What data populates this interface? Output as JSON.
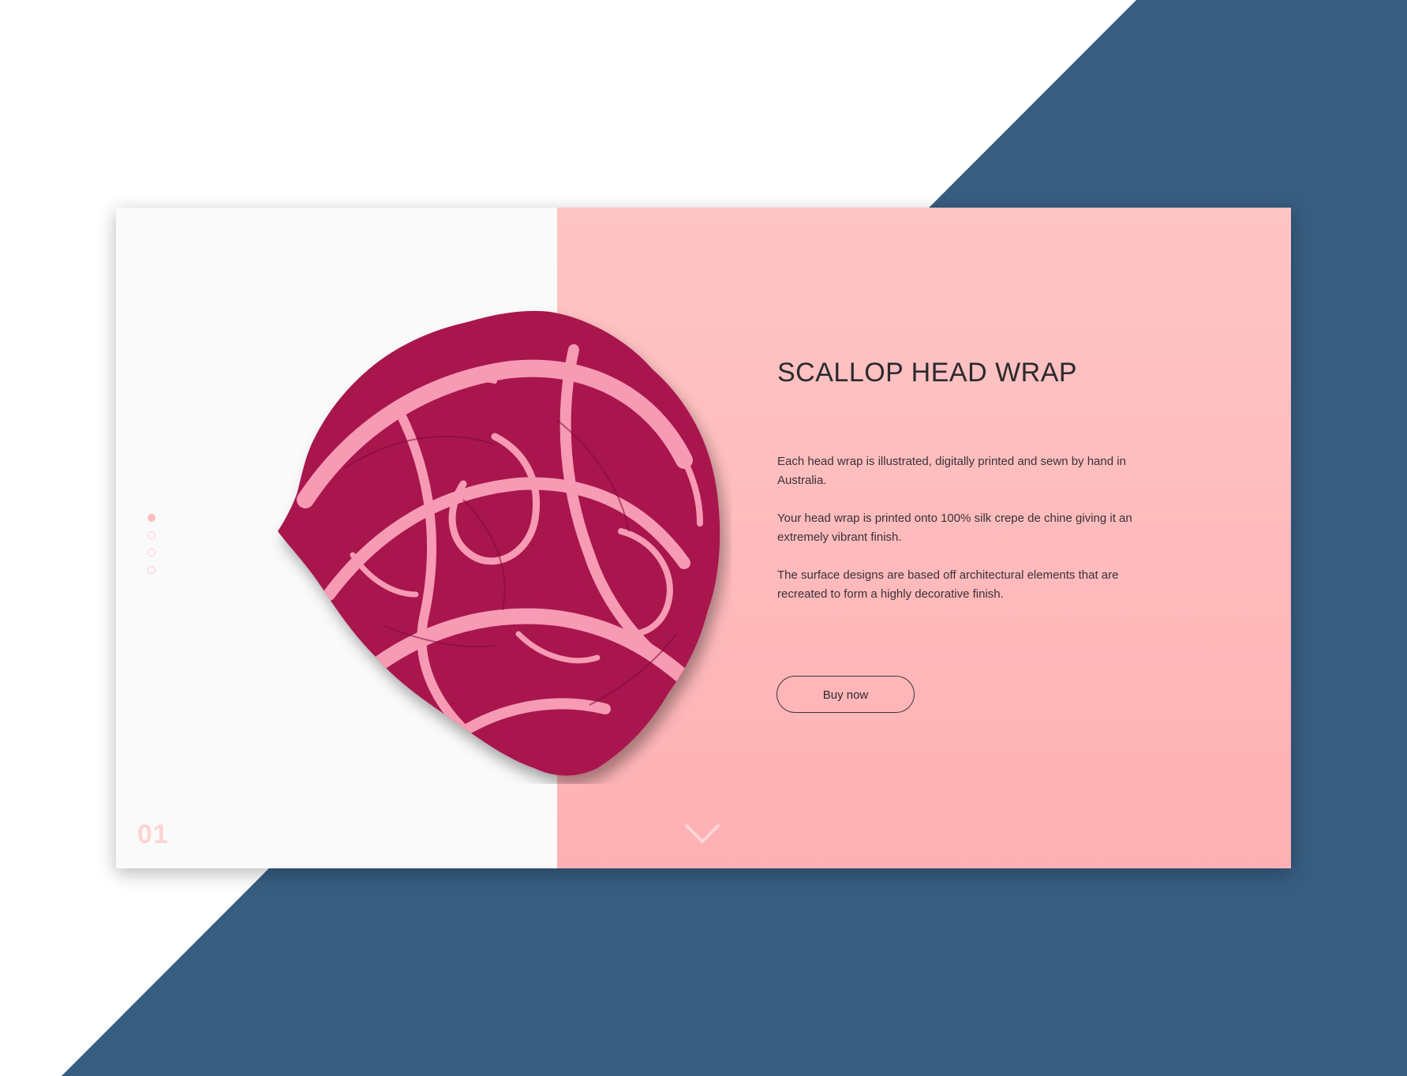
{
  "colors": {
    "navy_background": "#375d80",
    "left_panel": "#fafafa",
    "pink_panel_top": "#fec5c5",
    "pink_panel_bottom": "#feb1b4",
    "scarf_dark": "#a8174e",
    "scarf_light": "#f79ab4",
    "title_text": "#2a2a2e",
    "accent_pink": "#fbbdbd"
  },
  "product": {
    "title": "SCALLOP HEAD WRAP",
    "image_icon": "scarf-image",
    "description": [
      "Each head wrap is illustrated, digitally printed and sewn by hand in Australia.",
      "Your head wrap is printed onto 100% silk crepe de chine giving it an extremely vibrant finish.",
      "The surface designs are based off architectural elements that are recreated to form a highly decorative finish."
    ],
    "buy_label": "Buy now"
  },
  "slider": {
    "current_number": "01",
    "total_dots": 4,
    "active_index": 1
  },
  "scroll": {
    "icon": "chevron-down-icon"
  }
}
